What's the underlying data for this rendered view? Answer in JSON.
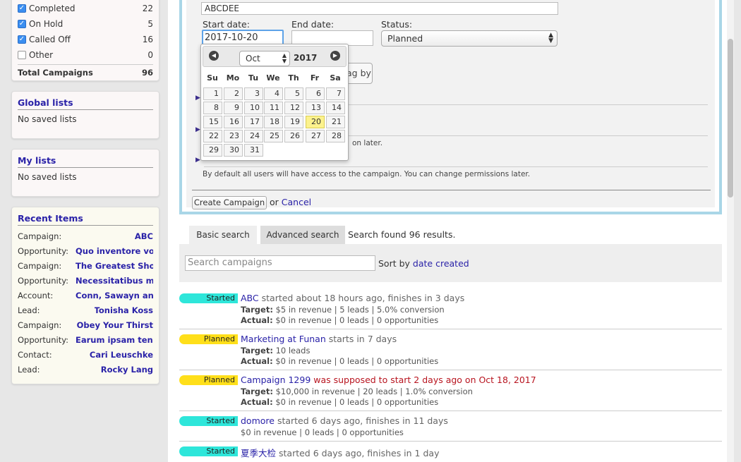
{
  "sidebar": {
    "statuses": [
      {
        "label": "Completed",
        "count": "22",
        "checked": true
      },
      {
        "label": "On Hold",
        "count": "5",
        "checked": true
      },
      {
        "label": "Called Off",
        "count": "16",
        "checked": true
      },
      {
        "label": "Other",
        "count": "0",
        "checked": false
      }
    ],
    "total_label": "Total Campaigns",
    "total_count": "96",
    "global_lists": {
      "title": "Global lists",
      "empty": "No saved lists"
    },
    "my_lists": {
      "title": "My lists",
      "empty": "No saved lists"
    },
    "recent": {
      "title": "Recent Items",
      "items": [
        {
          "type": "Campaign:",
          "name": "ABC"
        },
        {
          "type": "Opportunity:",
          "name": "Quo inventore vo..."
        },
        {
          "type": "Campaign:",
          "name": "The Greatest Sho..."
        },
        {
          "type": "Opportunity:",
          "name": "Necessitatibus m..."
        },
        {
          "type": "Account:",
          "name": "Conn, Sawayn and..."
        },
        {
          "type": "Lead:",
          "name": "Tonisha Koss"
        },
        {
          "type": "Campaign:",
          "name": "Obey Your Thirst"
        },
        {
          "type": "Opportunity:",
          "name": "Earum ipsam tene..."
        },
        {
          "type": "Contact:",
          "name": "Cari Leuschke"
        },
        {
          "type": "Lead:",
          "name": "Rocky Lang"
        }
      ]
    }
  },
  "form": {
    "name_value": "ABCDEE",
    "start_label": "Start date:",
    "start_value": "2017-10-20",
    "end_label": "End date:",
    "end_value": "",
    "status_label": "Status:",
    "status_value": "Planned",
    "tag_btn_partial": "ag by",
    "partial_text_1": "on later.",
    "permissions_text": "By default all users will have access to the campaign. You can change permissions later.",
    "create_label": "Create Campaign",
    "or_text": "or",
    "cancel_label": "Cancel"
  },
  "datepicker": {
    "month": "Oct",
    "year": "2017",
    "dow": [
      "Su",
      "Mo",
      "Tu",
      "We",
      "Th",
      "Fr",
      "Sa"
    ],
    "selected_day": "20",
    "weeks": [
      [
        "1",
        "2",
        "3",
        "4",
        "5",
        "6",
        "7"
      ],
      [
        "8",
        "9",
        "10",
        "11",
        "12",
        "13",
        "14"
      ],
      [
        "15",
        "16",
        "17",
        "18",
        "19",
        "20",
        "21"
      ],
      [
        "22",
        "23",
        "24",
        "25",
        "26",
        "27",
        "28"
      ],
      [
        "29",
        "30",
        "31",
        "",
        "",
        "",
        ""
      ]
    ]
  },
  "search": {
    "basic_tab": "Basic search",
    "advanced_tab": "Advanced search",
    "found_text": "Search found 96 results.",
    "placeholder": "Search campaigns",
    "sort_label": "Sort by",
    "sort_value": "date created"
  },
  "results": [
    {
      "status": "Started",
      "name": "ABC",
      "desc": " started about 18 hours ago, finishes in 3 days",
      "warn": false,
      "line1_label": "Target:",
      "line1": " $5 in revenue | 5 leads | 5.0% conversion",
      "line2_label": "Actual:",
      "line2": " $0 in revenue | 0 leads | 0 opportunities"
    },
    {
      "status": "Planned",
      "name": "Marketing at Funan",
      "desc": " starts in 7 days",
      "warn": false,
      "line1_label": "Target:",
      "line1": " 10 leads",
      "line2_label": "Actual:",
      "line2": " $0 in revenue | 0 leads | 0 opportunities"
    },
    {
      "status": "Planned",
      "name": "Campaign 1299",
      "desc": " was supposed to start 2 days ago on Oct 18, 2017",
      "warn": true,
      "line1_label": "Target:",
      "line1": " $10,000 in revenue | 20 leads | 1.0% conversion",
      "line2_label": "Actual:",
      "line2": " $0 in revenue | 0 leads | 0 opportunities"
    },
    {
      "status": "Started",
      "name": "domore",
      "desc": " started 6 days ago, finishes in 11 days",
      "warn": false,
      "line1_label": "",
      "line1": "$0 in revenue | 0 leads | 0 opportunities",
      "line2_label": "",
      "line2": ""
    },
    {
      "status": "Started",
      "name": "夏季大检",
      "desc": " started 6 days ago, finishes in 1 day",
      "warn": false,
      "line1_label": "",
      "line1": "",
      "line2_label": "",
      "line2": ""
    }
  ],
  "colors": {
    "started": "#2ee6da",
    "planned": "#ffdf1a",
    "link": "#2a22a8",
    "warn": "#b8141f"
  }
}
